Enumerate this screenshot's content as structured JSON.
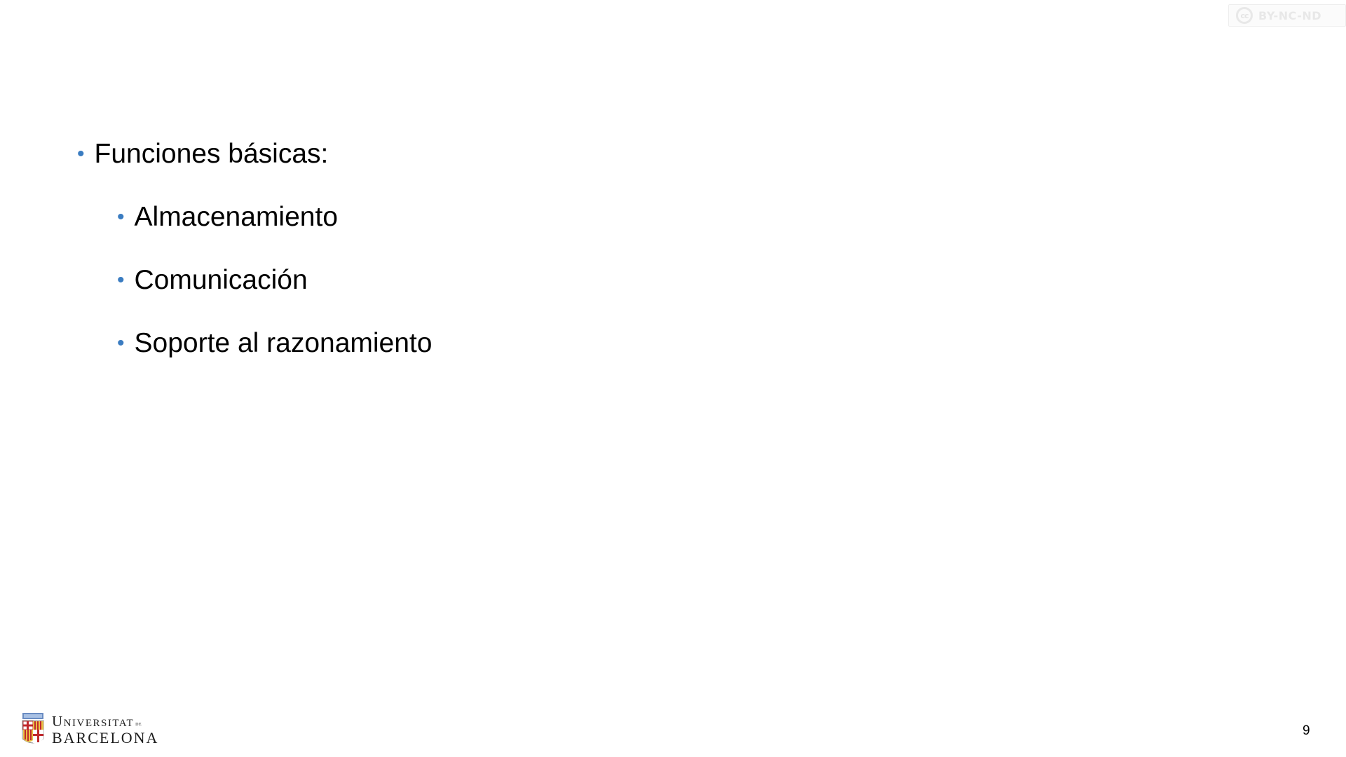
{
  "license_badge": {
    "symbol": "cc",
    "text": "BY-NC-ND"
  },
  "content": {
    "items": [
      {
        "level": 1,
        "text": "Funciones básicas:"
      },
      {
        "level": 2,
        "text": "Almacenamiento"
      },
      {
        "level": 2,
        "text": "Comunicación"
      },
      {
        "level": 2,
        "text": "Soporte al razonamiento"
      }
    ],
    "bullet_color": "#3a7cc1"
  },
  "footer": {
    "logo": {
      "line1": "Universitat",
      "line1_suffix": "de",
      "line2": "BARCELONA"
    },
    "page_number": "9"
  }
}
